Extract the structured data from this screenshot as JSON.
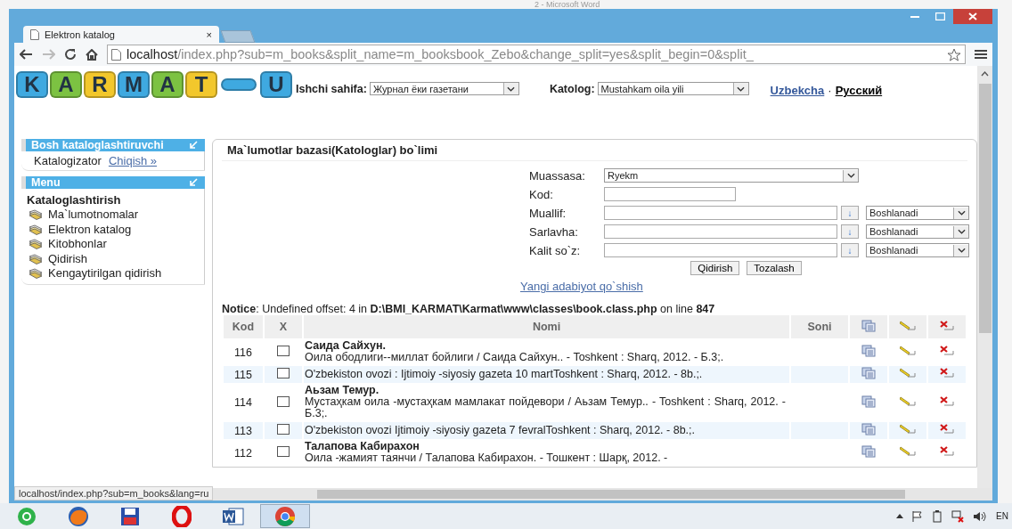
{
  "desktop": {
    "background_window_title": "2 - Microsoft Word"
  },
  "browser": {
    "tabs": [
      {
        "label": "Elektron katalog",
        "close": "×",
        "selected": true
      }
    ],
    "address": {
      "host": "localhost",
      "path": "/index.php?sub=m_books&split_name=m_booksbook_Zebo&change_split=yes&split_begin=0&split_"
    },
    "forward_disabled": true,
    "status_url": "localhost/index.php?sub=m_books&lang=ru"
  },
  "header": {
    "logo": [
      {
        "kind": "letter",
        "text": "K",
        "color": "#3fa9e0"
      },
      {
        "kind": "letter",
        "text": "A",
        "color": "#7cc242"
      },
      {
        "kind": "letter",
        "text": "R",
        "color": "#f2c72c"
      },
      {
        "kind": "letter",
        "text": "M",
        "color": "#3fa9e0"
      },
      {
        "kind": "letter",
        "text": "A",
        "color": "#7cc242"
      },
      {
        "kind": "letter",
        "text": "T",
        "color": "#f2c72c"
      },
      {
        "kind": "bar",
        "color": "#3fa9e0"
      },
      {
        "kind": "letter",
        "text": "U",
        "color": "#3fa9e0"
      }
    ],
    "work_page": {
      "label": "Ishchi sahifa:",
      "value": "Журнал ёки газетани"
    },
    "catalog": {
      "label": "Katolog:",
      "value": "Mustahkam oila yili"
    },
    "languages": [
      {
        "label": "Uzbekcha",
        "selected": false
      },
      {
        "label": "Русский",
        "selected": true
      }
    ],
    "language_separator": "·"
  },
  "sidebar": {
    "user_panel": {
      "title": "Bosh kataloglashtiruvchi",
      "user": "Katalogizator",
      "logout": "Chiqish »"
    },
    "menu_panel": {
      "title": "Menu",
      "section": "Kataloglashtirish",
      "items": [
        "Ma`lumotnomalar",
        "Elektron katalog",
        "Kitobhonlar",
        "Qidirish",
        "Kengaytirilgan qidirish"
      ]
    }
  },
  "main": {
    "title": "Ma`lumotlar bazasi(Katologlar) bo`limi",
    "form": {
      "fields": [
        {
          "kind": "select",
          "label": "Muassasa:",
          "value": "Ryekm"
        },
        {
          "kind": "input",
          "label": "Kod:"
        },
        {
          "kind": "match",
          "label": "Muallif:",
          "arrow": "↓",
          "mode": "Boshlanadi"
        },
        {
          "kind": "match",
          "label": "Sarlavha:",
          "arrow": "↓",
          "mode": "Boshlanadi"
        },
        {
          "kind": "match",
          "label": "Kalit so`z:",
          "arrow": "↓",
          "mode": "Boshlanadi"
        }
      ],
      "buttons": [
        "Qidirish",
        "Tozalash"
      ],
      "add_link": "Yangi adabiyot qo`shish"
    },
    "notice": "**Notice**: Undefined offset: 4 in **D:\\BMI_KARMAT\\Karmat\\www\\classes\\book.class.php** on line **847**",
    "table": {
      "columns": [
        {
          "kind": "text",
          "label": "Kod"
        },
        {
          "kind": "text",
          "label": "X"
        },
        {
          "kind": "text",
          "label": "Nomi"
        },
        {
          "kind": "text",
          "label": "Soni"
        },
        {
          "kind": "copy"
        },
        {
          "kind": "edit"
        },
        {
          "kind": "delete"
        }
      ],
      "rows": [
        {
          "kod": "116",
          "checked": false,
          "author": "Саида Сайхун.",
          "description": "Оила ободлиги--миллат бойлиги / Саида Сайхун.. - Toshkent : Sharq, 2012. - Б.3;."
        },
        {
          "kod": "115",
          "checked": false,
          "description": "O'zbekiston ovozi : Ijtimoiy -siyosiy gazeta 10 martToshkent : Sharq, 2012. - 8b.;."
        },
        {
          "kod": "114",
          "checked": false,
          "author": "Аьзам Темур.",
          "description": "Мустаҳкам оила -мустаҳкам мамлакат пойдевори / Аьзам Темур.. - Toshkent : Sharq, 2012. - Б.3;."
        },
        {
          "kod": "113",
          "checked": false,
          "description": "O'zbekiston ovozi Ijtimoiy -siyosiy gazeta 7 fevralToshkent : Sharq, 2012. - 8b.;."
        },
        {
          "kod": "112",
          "checked": false,
          "author": "Талапова Кабирахон",
          "description": "Оила -жамият таянчи / Талапова Кабирахон. - Тошкент : Шарқ, 2012. -"
        }
      ]
    }
  },
  "taskbar": {
    "apps": [
      {
        "kind": "agent",
        "selected": false
      },
      {
        "kind": "firefox",
        "selected": false
      },
      {
        "kind": "floppy",
        "selected": false
      },
      {
        "kind": "opera",
        "selected": false
      },
      {
        "kind": "word",
        "selected": false
      },
      {
        "kind": "chrome",
        "selected": true
      }
    ],
    "language": "EN"
  }
}
